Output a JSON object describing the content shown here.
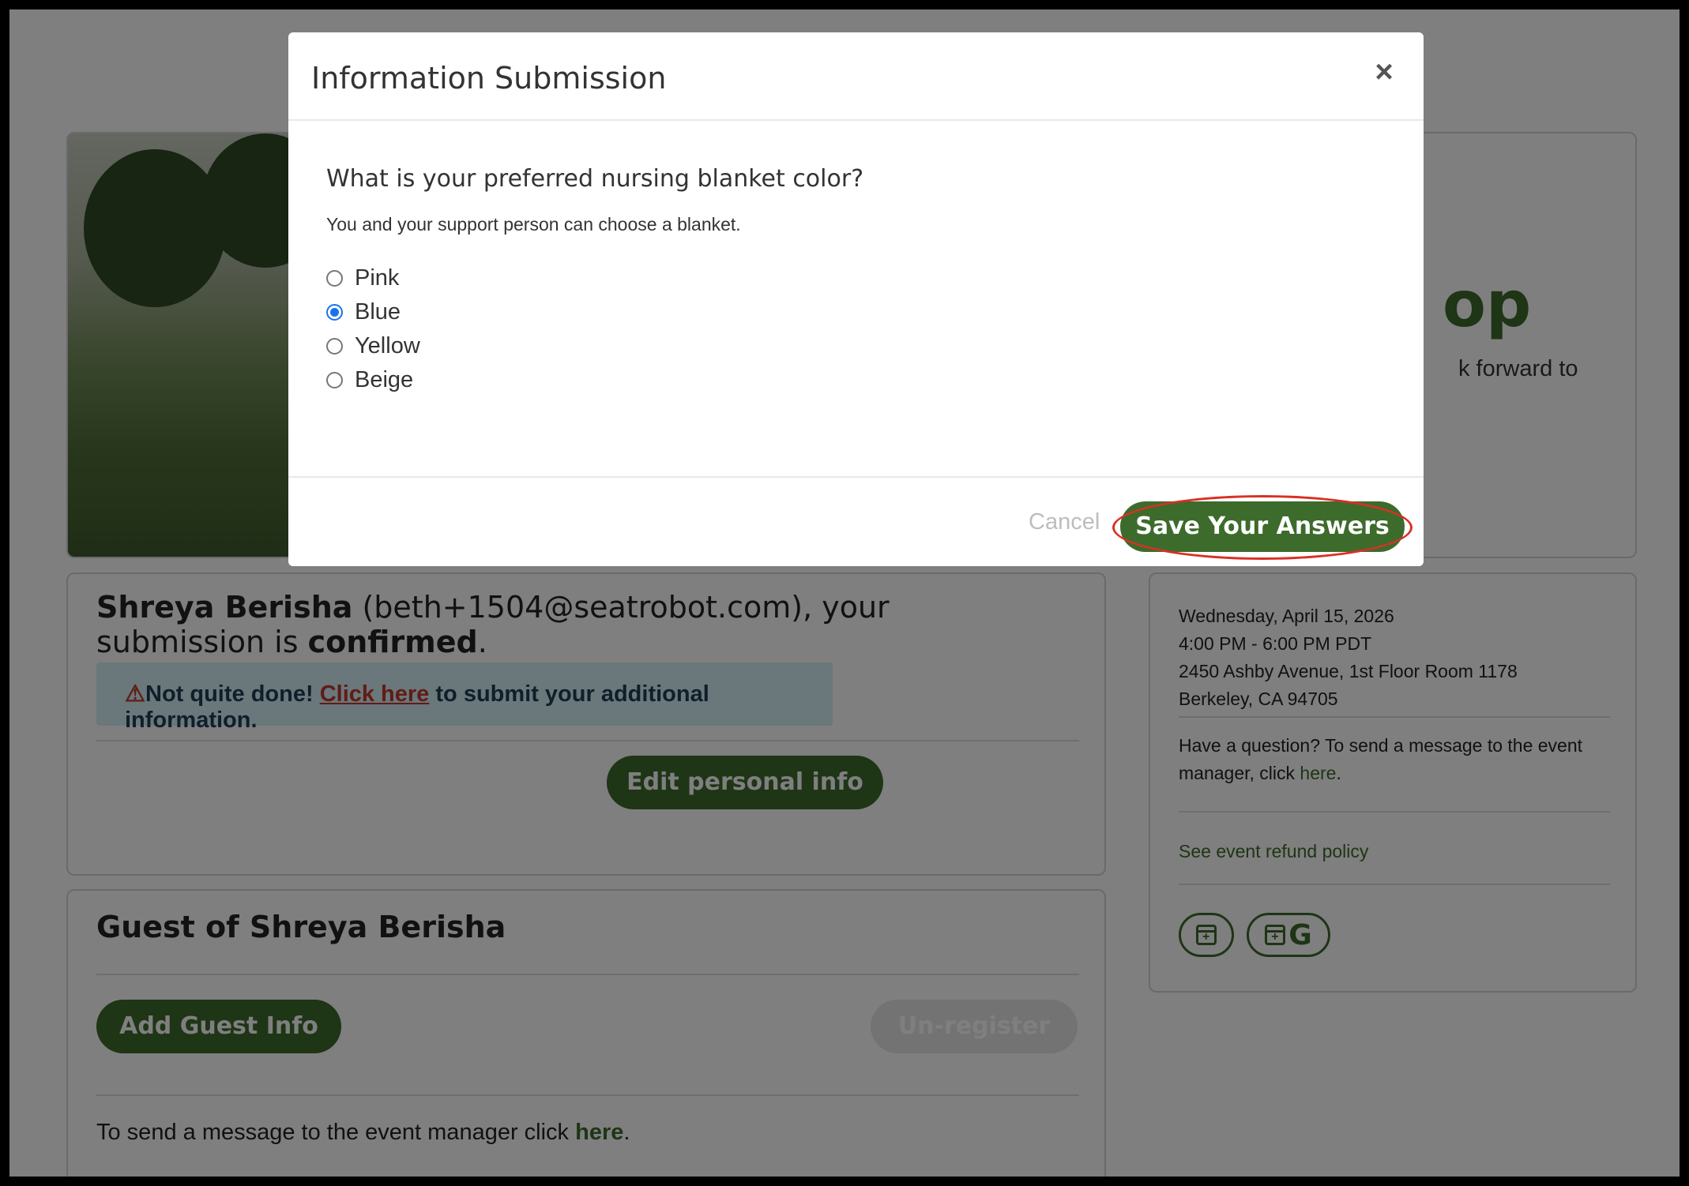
{
  "hero": {
    "title_fragment": "op",
    "subtitle_fragment": "k forward to"
  },
  "confirmation": {
    "name": "Shreya Berisha",
    "email_text": " (beth+1504@seatrobot.com), your submission is ",
    "confirmed_word": "confirmed",
    "period": ".",
    "alert_icon": "⚠",
    "alert_prefix": "Not quite done! ",
    "alert_link": "Click here",
    "alert_suffix": " to submit your additional information.",
    "edit_button": "Edit personal info"
  },
  "guest": {
    "title": "Guest of Shreya Berisha",
    "add_button": "Add Guest Info",
    "unregister_button": "Un-register",
    "message_prefix": "To send a message to the event manager click ",
    "message_link": "here",
    "message_suffix": "."
  },
  "event_info": {
    "date": "Wednesday, April 15, 2026",
    "time": "4:00 PM - 6:00 PM PDT",
    "address_line1": "2450 Ashby Avenue, 1st Floor Room 1178",
    "address_line2": "Berkeley, CA 94705",
    "question_prefix": "Have a question? To send a message to the event manager, click ",
    "question_link": "here",
    "question_suffix": ".",
    "refund_link": "See event refund policy",
    "google_letter": "G"
  },
  "modal": {
    "title": "Information Submission",
    "close_icon": "×",
    "question": "What is your preferred nursing blanket color?",
    "help": "You and your support person can choose a blanket.",
    "options": [
      {
        "label": "Pink",
        "checked": false
      },
      {
        "label": "Blue",
        "checked": true
      },
      {
        "label": "Yellow",
        "checked": false
      },
      {
        "label": "Beige",
        "checked": false
      }
    ],
    "cancel": "Cancel",
    "save": "Save Your Answers"
  },
  "colors": {
    "brand_green": "#3d6b2c",
    "radio_selected": "#1a73e8",
    "highlight_red": "#d93025"
  }
}
